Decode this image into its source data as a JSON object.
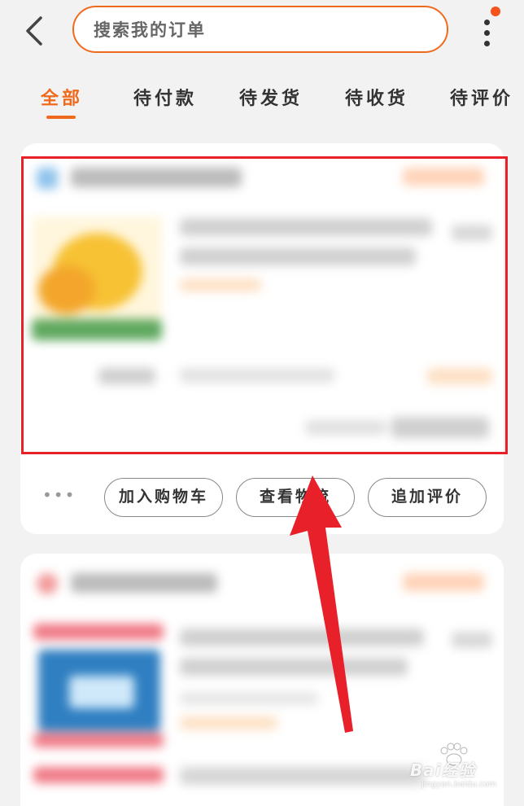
{
  "search": {
    "placeholder": "搜索我的订单"
  },
  "tabs": [
    {
      "label": "全部",
      "active": true
    },
    {
      "label": "待付款"
    },
    {
      "label": "待发货"
    },
    {
      "label": "待收货"
    },
    {
      "label": "待评价"
    }
  ],
  "order_actions": {
    "more": "•••",
    "add_to_cart": "加入购物车",
    "view_logistics": "查看物流",
    "add_review": "追加评价"
  },
  "colors": {
    "accent": "#f06a1d",
    "highlight": "#e8202a",
    "background": "#f2f2f2"
  },
  "icons": [
    "back-arrow-icon",
    "more-vertical-icon",
    "notification-dot"
  ],
  "watermark": {
    "text": "Bai经验",
    "sub": "jingyan.baidu.com"
  }
}
